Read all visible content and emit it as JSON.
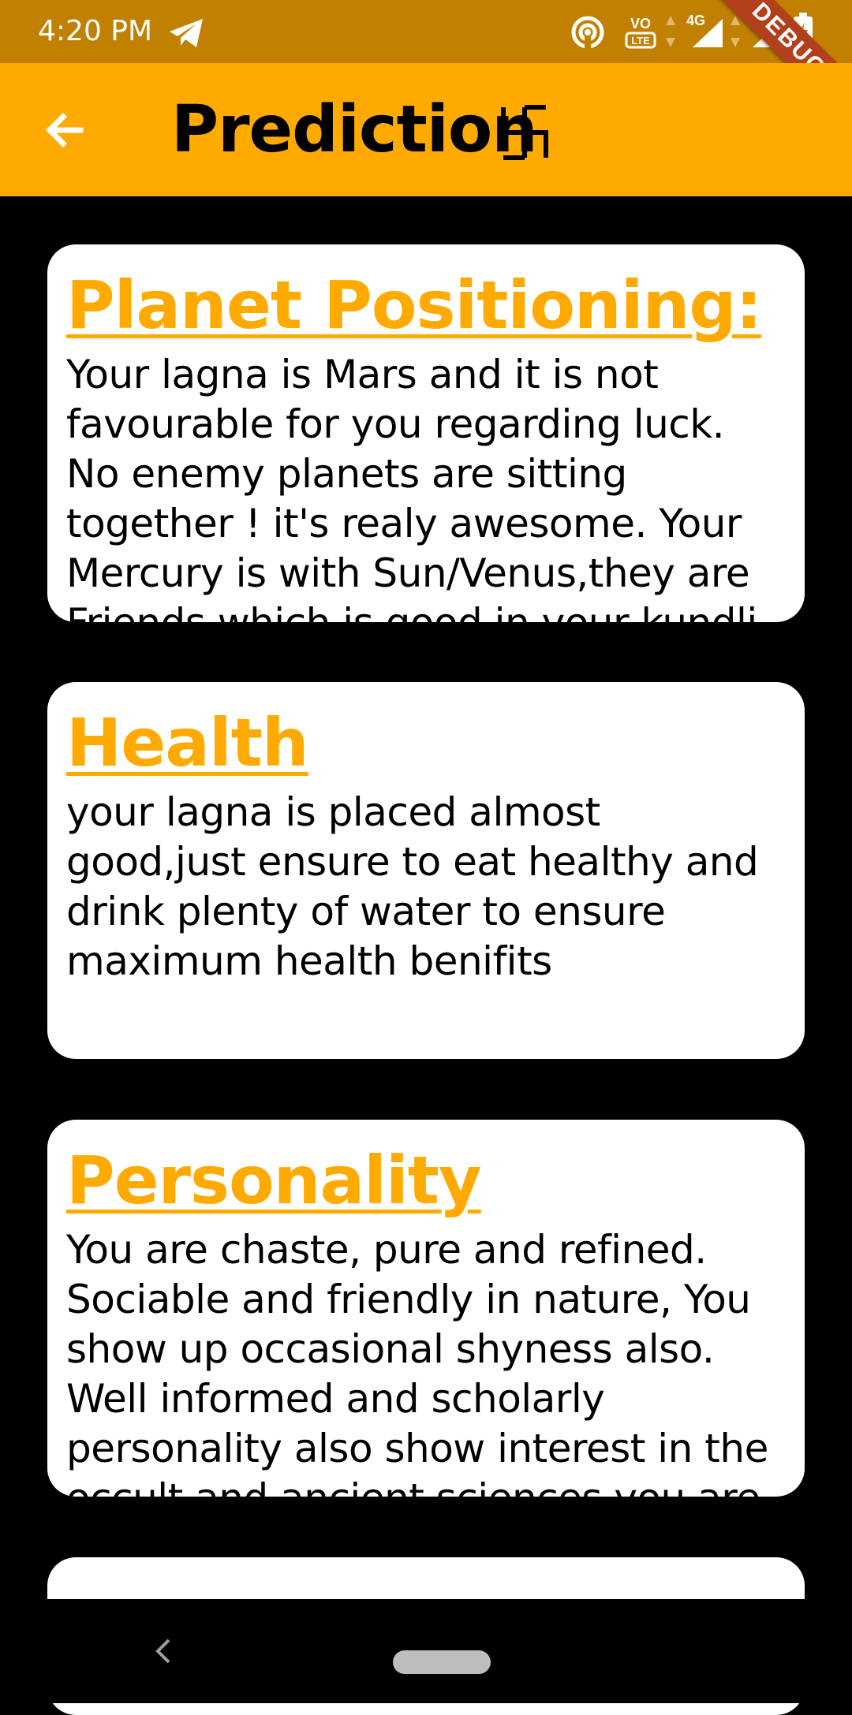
{
  "status_bar": {
    "time": "4:20 PM",
    "network_label": "4G",
    "volte_label": "VO LTE",
    "debug_label": "DEBUG"
  },
  "app_bar": {
    "title": "Prediction",
    "title_symbol": "swastika-icon",
    "color": "#ffaa00"
  },
  "cards": [
    {
      "title": "Planet Positioning:",
      "body": "Your lagna is Mars and it is not favourable for you regarding luck. No enemy planets are sitting together ! it's realy awesome. Your Mercury is with Sun/Venus,they are Friends which is good in your kundli"
    },
    {
      "title": "Health",
      "body": "your lagna is placed almost good,just ensure to eat healthy and drink plenty of water to ensure maximum health benifits"
    },
    {
      "title": "Personality",
      "body": "You are chaste, pure and refined. Sociable and friendly in nature, You show up occasional shyness also. Well informed and scholarly personality also show interest in the occult and ancient sciences you are"
    }
  ],
  "colors": {
    "status_bar": "#c18000",
    "accent": "#ffaa00",
    "background": "#000000",
    "card": "#ffffff"
  }
}
